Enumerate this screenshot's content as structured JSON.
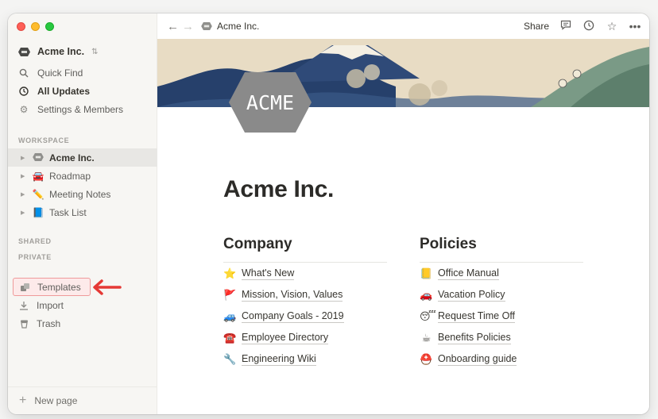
{
  "workspace": {
    "name": "Acme Inc."
  },
  "nav": [
    {
      "label": "Quick Find",
      "icon": "search-icon"
    },
    {
      "label": "All Updates",
      "icon": "clock-icon"
    },
    {
      "label": "Settings & Members",
      "icon": "gear-icon"
    }
  ],
  "sections": {
    "workspace": "WORKSPACE",
    "shared": "SHARED",
    "private": "PRIVATE"
  },
  "pages": [
    {
      "label": "Acme Inc.",
      "emoji": ""
    },
    {
      "label": "Roadmap",
      "emoji": "🚘"
    },
    {
      "label": "Meeting Notes",
      "emoji": "✏️"
    },
    {
      "label": "Task List",
      "emoji": "📘"
    }
  ],
  "bottom": [
    {
      "label": "Templates",
      "icon": "templates-icon"
    },
    {
      "label": "Import",
      "icon": "import-icon"
    },
    {
      "label": "Trash",
      "icon": "trash-icon"
    }
  ],
  "new_page": "New page",
  "topbar": {
    "breadcrumb": "Acme Inc.",
    "share": "Share"
  },
  "logo_text": "ACME",
  "page_title": "Acme Inc.",
  "company": {
    "heading": "Company",
    "links": [
      {
        "emoji": "⭐",
        "label": "What's New"
      },
      {
        "emoji": "🚩",
        "label": "Mission, Vision, Values"
      },
      {
        "emoji": "🚙",
        "label": "Company Goals - 2019"
      },
      {
        "emoji": "☎️",
        "label": "Employee Directory"
      },
      {
        "emoji": "🔧",
        "label": "Engineering Wiki"
      }
    ]
  },
  "policies": {
    "heading": "Policies",
    "links": [
      {
        "emoji": "📒",
        "label": "Office Manual"
      },
      {
        "emoji": "🚗",
        "label": "Vacation Policy"
      },
      {
        "emoji": "😴",
        "label": "Request Time Off"
      },
      {
        "emoji": "☕",
        "label": "Benefits Policies"
      },
      {
        "emoji": "⛑️",
        "label": "Onboarding guide"
      }
    ]
  }
}
